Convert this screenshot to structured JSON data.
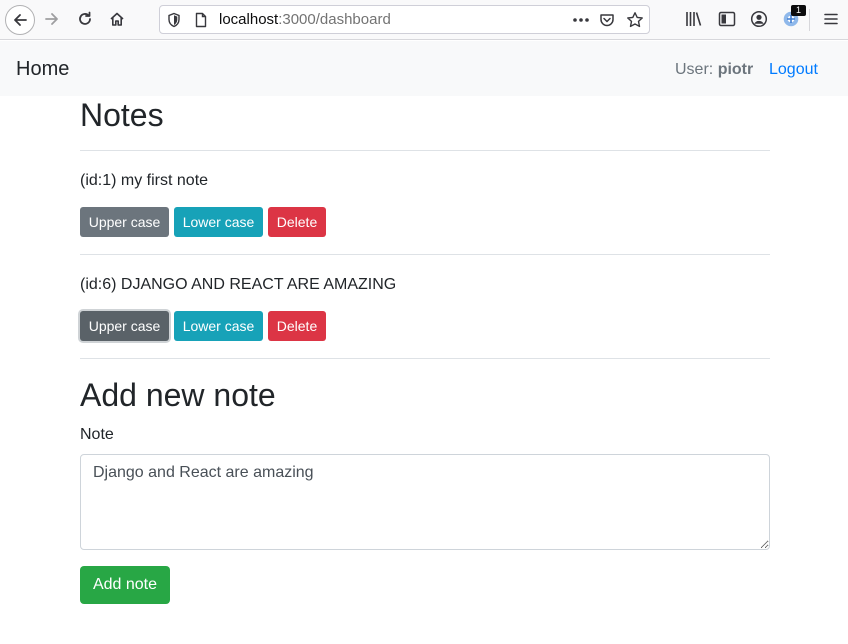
{
  "browser": {
    "url_host": "localhost",
    "url_path": ":3000/dashboard",
    "extension_badge": "1"
  },
  "navbar": {
    "home_label": "Home",
    "user_prefix": "User:",
    "username": "piotr",
    "logout_label": "Logout"
  },
  "notes": {
    "title": "Notes",
    "items": [
      {
        "text": "(id:1) my first note",
        "upper_label": "Upper case",
        "lower_label": "Lower case",
        "delete_label": "Delete"
      },
      {
        "text": "(id:6) DJANGO AND REACT ARE AMAZING",
        "upper_label": "Upper case",
        "lower_label": "Lower case",
        "delete_label": "Delete"
      }
    ]
  },
  "add_form": {
    "title": "Add new note",
    "note_label": "Note",
    "note_value": "Django and React are amazing",
    "submit_label": "Add note"
  },
  "colors": {
    "secondary": "#6c757d",
    "info": "#17a2b8",
    "danger": "#dc3545",
    "success": "#28a745",
    "link": "#007bff"
  }
}
